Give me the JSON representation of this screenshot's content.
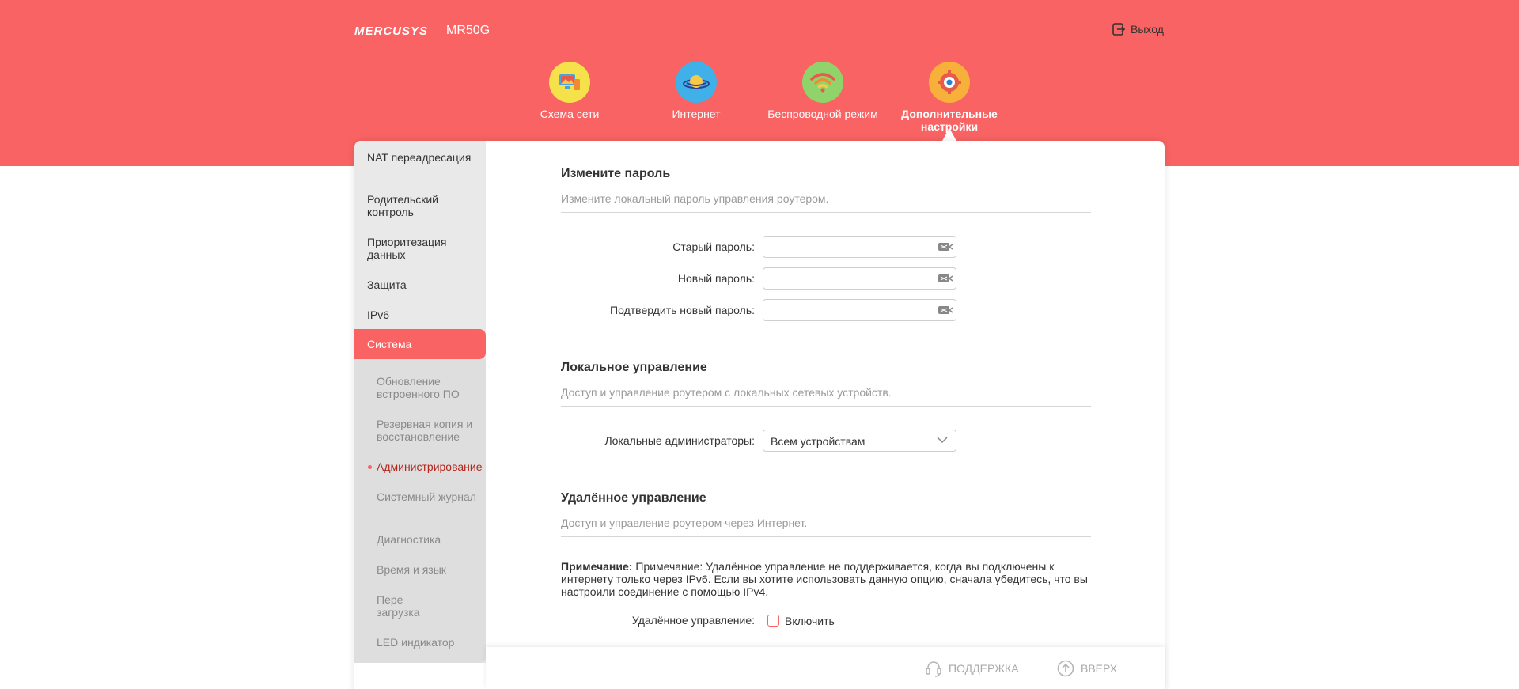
{
  "header": {
    "brand": "MERCUSYS",
    "model": "MR50G",
    "logout_label": "Выход"
  },
  "nav": [
    {
      "label": "Схема сети",
      "icon": "network-map-icon",
      "color": "#f5e14a"
    },
    {
      "label": "Интернет",
      "icon": "internet-planet-icon",
      "color": "#3fb1e8"
    },
    {
      "label": "Беспроводной режим",
      "icon": "wifi-icon",
      "color": "#8fd36a"
    },
    {
      "label": "Дополнительные настройки",
      "icon": "advanced-gear-icon",
      "color": "#f7b13b"
    }
  ],
  "sidebar": {
    "items": [
      {
        "label": "NAT переадресация"
      },
      {
        "label": "Родительский контроль"
      },
      {
        "label": "Приоритезация данных"
      },
      {
        "label": "Защита"
      },
      {
        "label": "IPv6"
      },
      {
        "label": "Система"
      }
    ],
    "subitems": [
      {
        "label": "Обновление встроенного ПО"
      },
      {
        "label": "Резервная копия и восстановление"
      },
      {
        "label": "Администрирование"
      },
      {
        "label": "Системный журнал"
      },
      {
        "label": "Диагностика"
      },
      {
        "label": "Время и язык"
      },
      {
        "label": "Пере загрузка"
      },
      {
        "label": "LED индикатор"
      }
    ]
  },
  "password_section": {
    "title": "Измените пароль",
    "desc": "Измените локальный пароль управления роутером.",
    "old_label": "Старый пароль:",
    "new_label": "Новый пароль:",
    "confirm_label": "Подтвердить новый пароль:"
  },
  "local_section": {
    "title": "Локальное управление",
    "desc": "Доступ и управление роутером с локальных сетевых устройств.",
    "admins_label": "Локальные администраторы:",
    "admins_value": "Всем устройствам"
  },
  "remote_section": {
    "title": "Удалённое управление",
    "desc": "Доступ и управление роутером через Интернет.",
    "note_label": "Примечание:",
    "note_text": " Примечание: Удалённое управление не поддерживается, когда вы подключены к интернету только через IPv6. Если вы хотите использовать данную опцию, сначала убедитесь, что вы настроили соединение с помощью IPv4.",
    "remote_label": "Удалённое управление:",
    "enable_label": "Включить"
  },
  "footer": {
    "support_label": "ПОДДЕРЖКА",
    "top_label": "ВВЕРХ"
  },
  "colors": {
    "accent": "#fa6363",
    "active_sub": "#b3261e"
  }
}
